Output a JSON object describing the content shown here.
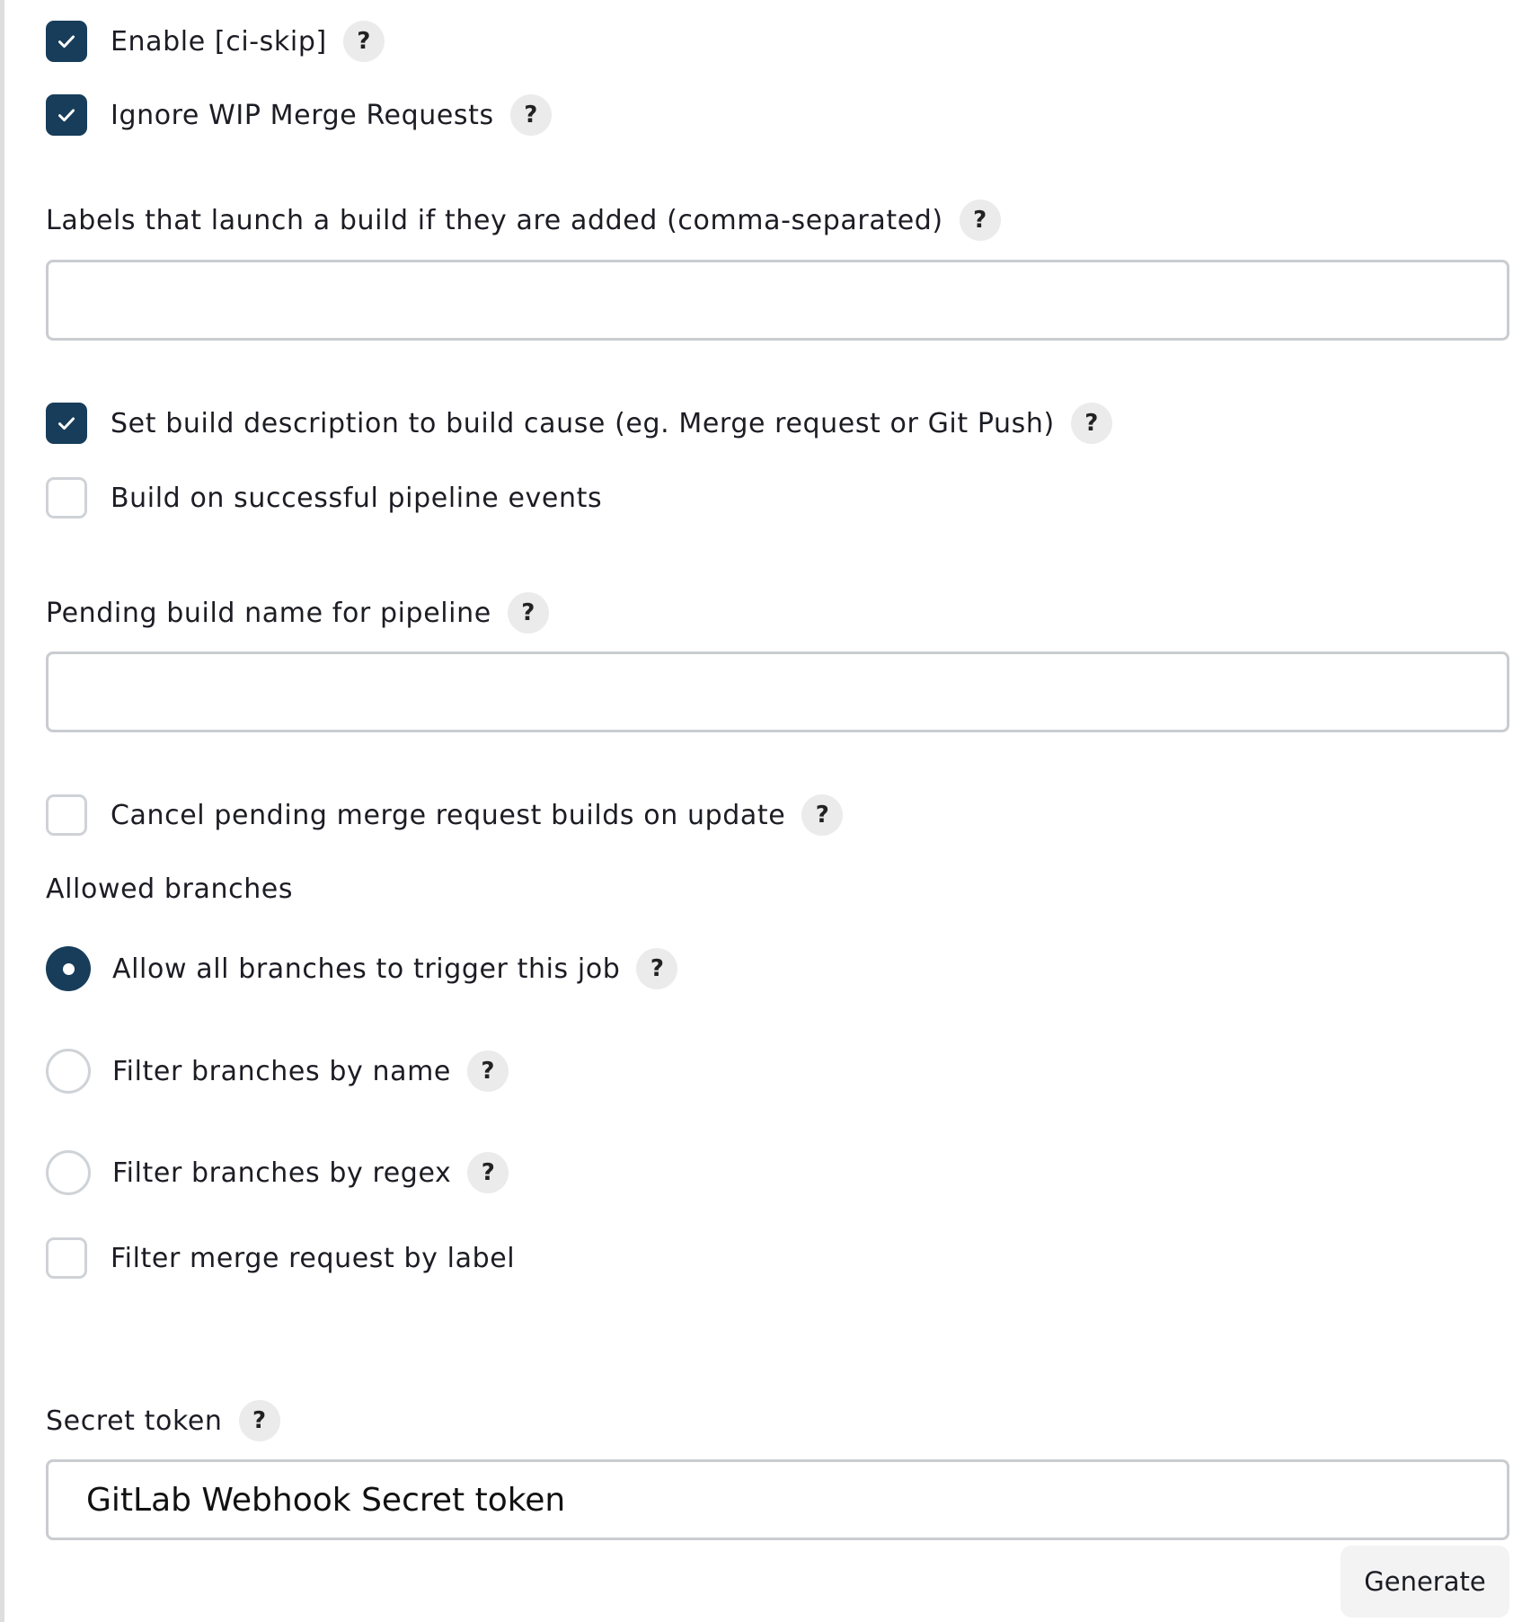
{
  "options_top": {
    "ci_skip": {
      "label": "Enable [ci-skip]",
      "checked": true
    },
    "ignore_wip": {
      "label": "Ignore WIP Merge Requests",
      "checked": true
    }
  },
  "labels_field": {
    "label": "Labels that launch a build if they are added (comma-separated)",
    "value": ""
  },
  "options_mid": {
    "set_description": {
      "label": "Set build description to build cause (eg. Merge request or Git Push)",
      "checked": true
    },
    "pipeline_events": {
      "label": "Build on successful pipeline events",
      "checked": false
    }
  },
  "pending_build": {
    "label": "Pending build name for pipeline",
    "value": ""
  },
  "cancel_pending": {
    "label": "Cancel pending merge request builds on update",
    "checked": false
  },
  "allowed_branches": {
    "heading": "Allowed branches",
    "options": [
      {
        "label": "Allow all branches to trigger this job",
        "selected": true
      },
      {
        "label": "Filter branches by name",
        "selected": false
      },
      {
        "label": "Filter branches by regex",
        "selected": false
      }
    ]
  },
  "filter_by_label": {
    "label": "Filter merge request by label",
    "checked": false
  },
  "secret_token": {
    "label": "Secret token",
    "value": "GitLab Webhook Secret token"
  },
  "generate_button": {
    "label": "Generate"
  },
  "help_glyph": "?",
  "colors": {
    "accent": "#173d5a",
    "border": "#cfd3d7",
    "help_bg": "#ebebeb"
  }
}
